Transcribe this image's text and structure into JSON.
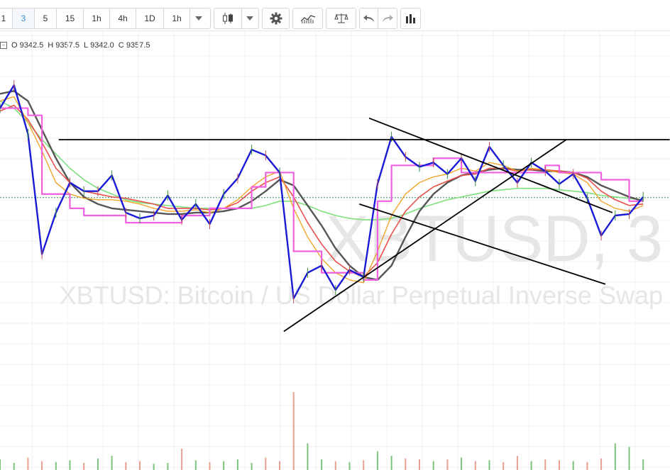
{
  "toolbar": {
    "intervals": [
      "1",
      "3",
      "5",
      "15",
      "1h",
      "4h",
      "1D",
      "1h"
    ],
    "active_interval": "3"
  },
  "ohlc": {
    "o_label": "O",
    "o_value": "9342.5",
    "h_label": "H",
    "h_value": "9357.5",
    "l_label": "L",
    "l_value": "9342.0",
    "c_label": "C",
    "c_value": "9357.5"
  },
  "watermark": {
    "symbol": "XBTUSD, 3",
    "description": "XBTUSD: Bitcoin / US Dollar Perpetual Inverse Swap"
  },
  "colors": {
    "price_line": "#1a1ad6",
    "ma_fast": "#f0a020",
    "ma_red": "#e8504a",
    "ma_dark": "#555555",
    "ma_green": "#7de07d",
    "step_pink": "#f060e0",
    "volume_up": "#7cc47c",
    "volume_down": "#e8a090",
    "trendline": "#000000",
    "last_price_line": "#2e8b57"
  },
  "chart_data": {
    "type": "line",
    "x_index": [
      0,
      1,
      2,
      3,
      4,
      5,
      6,
      7,
      8,
      9,
      10,
      11,
      12,
      13,
      14,
      15,
      16,
      17,
      18,
      19,
      20,
      21,
      22,
      23,
      24,
      25,
      26,
      27,
      28,
      29,
      30,
      31,
      32,
      33,
      34,
      35,
      36,
      37,
      38,
      39,
      40,
      41,
      42,
      43,
      44,
      45,
      46,
      47
    ],
    "series": [
      {
        "values": [
          9420,
          9436,
          9402,
          9318,
          9347,
          9368,
          9362,
          9362,
          9373,
          9347,
          9343,
          9345,
          9359,
          9342,
          9353,
          9339,
          9360,
          9371,
          9391,
          9387,
          9375,
          9287,
          9305,
          9310,
          9293,
          9307,
          9302,
          9367,
          9400,
          9386,
          9379,
          9382,
          9374,
          9385,
          9369,
          9393,
          9380,
          9368,
          9382,
          9376,
          9367,
          9374,
          9357,
          9331,
          9345,
          9346,
          9358
        ]
      },
      {
        "values": [
          9425,
          9428,
          9410,
          9390,
          9368,
          9360,
          9357,
          9356,
          9356,
          9355,
          9353,
          9350,
          9348,
          9348,
          9349,
          9347,
          9350,
          9356,
          9365,
          9372,
          9376,
          9350,
          9330,
          9315,
          9305,
          9300,
          9298,
          9320,
          9345,
          9360,
          9368,
          9372,
          9374,
          9378,
          9376,
          9382,
          9380,
          9376,
          9378,
          9377,
          9375,
          9374,
          9368,
          9355,
          9350,
          9348,
          9352
        ]
      },
      {
        "values": [
          9418,
          9422,
          9412,
          9396,
          9378,
          9368,
          9362,
          9360,
          9358,
          9357,
          9355,
          9353,
          9350,
          9350,
          9350,
          9349,
          9350,
          9354,
          9362,
          9368,
          9372,
          9358,
          9340,
          9325,
          9313,
          9306,
          9302,
          9312,
          9332,
          9348,
          9358,
          9365,
          9369,
          9373,
          9374,
          9378,
          9378,
          9376,
          9377,
          9377,
          9376,
          9375,
          9371,
          9362,
          9356,
          9352,
          9353
        ]
      },
      {
        "values": [
          9430,
          9432,
          9425,
          9405,
          9385,
          9368,
          9358,
          9353,
          9350,
          9349,
          9348,
          9347,
          9346,
          9346,
          9347,
          9347,
          9348,
          9350,
          9355,
          9362,
          9370,
          9366,
          9352,
          9338,
          9322,
          9310,
          9302,
          9300,
          9310,
          9330,
          9348,
          9360,
          9368,
          9373,
          9375,
          9377,
          9378,
          9377,
          9377,
          9376,
          9376,
          9375,
          9372,
          9366,
          9362,
          9358,
          9355
        ]
      },
      {
        "values": [
          9425,
          9420,
          9410,
          9398,
          9388,
          9378,
          9370,
          9364,
          9360,
          9356,
          9354,
          9353,
          9352,
          9351,
          9350,
          9350,
          9350,
          9350,
          9350,
          9352,
          9355,
          9355,
          9352,
          9348,
          9345,
          9343,
          9342,
          9342,
          9343,
          9346,
          9350,
          9353,
          9356,
          9358,
          9360,
          9362,
          9363,
          9364,
          9364,
          9364,
          9363,
          9362,
          9361,
          9359,
          9358,
          9357,
          9356
        ]
      },
      {
        "values": [
          9420,
          9420,
          9415,
          9360,
          9360,
          9350,
          9345,
          9345,
          9345,
          9340,
          9340,
          9340,
          9340,
          9345,
          9345,
          9350,
          9350,
          9350,
          9365,
          9375,
          9375,
          9320,
          9320,
          9305,
          9305,
          9305,
          9300,
          9355,
          9380,
          9380,
          9380,
          9385,
          9385,
          9375,
          9375,
          9375,
          9375,
          9375,
          9375,
          9380,
          9375,
          9375,
          9375,
          9370,
          9370,
          9355,
          9355
        ]
      }
    ],
    "volume": [
      12,
      8,
      14,
      10,
      9,
      11,
      8,
      13,
      16,
      9,
      10,
      7,
      8,
      24,
      11,
      9,
      10,
      12,
      8,
      14,
      10,
      88,
      30,
      12,
      10,
      9,
      11,
      21,
      16,
      13,
      12,
      10,
      12,
      14,
      10,
      11,
      9,
      16,
      10,
      12,
      11,
      10,
      9,
      13,
      30,
      26,
      12
    ],
    "yaxis_gridline_values": [
      9200,
      9250,
      9300,
      9350,
      9400,
      9450
    ],
    "last_price": 9357.5,
    "ylim": [
      9240,
      9450
    ],
    "trendlines": [
      {
        "p1": [
          4.2,
          9398
        ],
        "p2": [
          47.9,
          9398
        ]
      },
      {
        "p1": [
          20.3,
          9264
        ],
        "p2": [
          40.5,
          9398
        ]
      },
      {
        "p1": [
          26.4,
          9413
        ],
        "p2": [
          43.8,
          9347
        ]
      },
      {
        "p1": [
          25.7,
          9353
        ],
        "p2": [
          43.3,
          9297
        ]
      }
    ]
  }
}
